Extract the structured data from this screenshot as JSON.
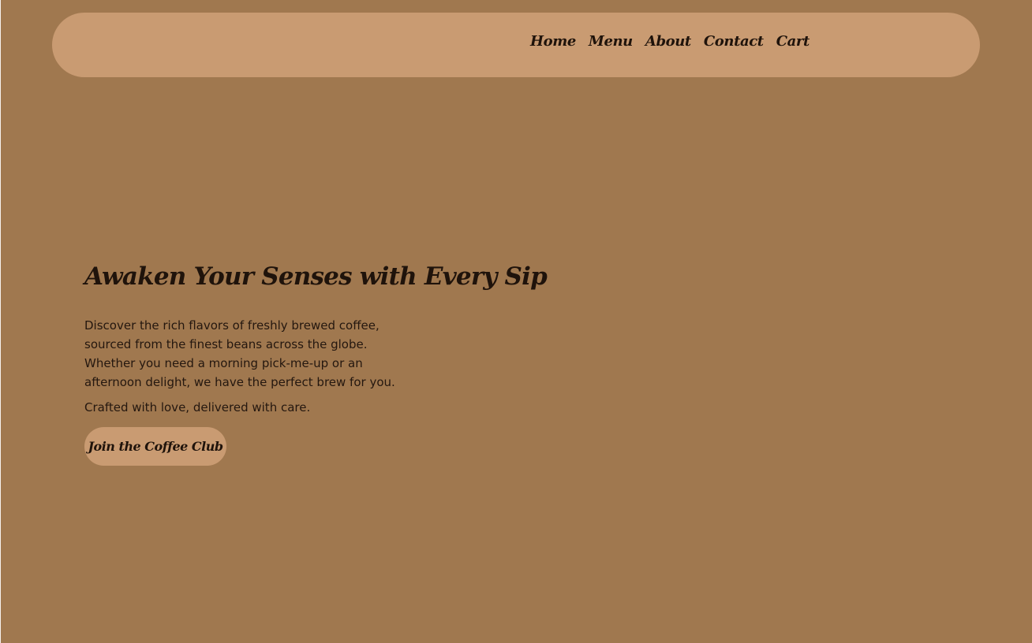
{
  "navbar": {
    "links": [
      "Home",
      "Menu",
      "About",
      "Contact",
      "Cart"
    ]
  },
  "hero": {
    "title": "Awaken Your Senses with Every Sip",
    "description": "Discover the rich flavors of freshly brewed coffee, sourced from the finest beans across the globe. Whether you need a morning pick-me-up or an afternoon delight, we have the perfect brew for you.",
    "tagline": "Crafted with love, delivered with care.",
    "button_label": "Join the Coffee Club"
  },
  "colors": {
    "background": "#a0784f",
    "navbar": "#c99b72",
    "text": "#1f130b",
    "button": "#c99b72"
  }
}
